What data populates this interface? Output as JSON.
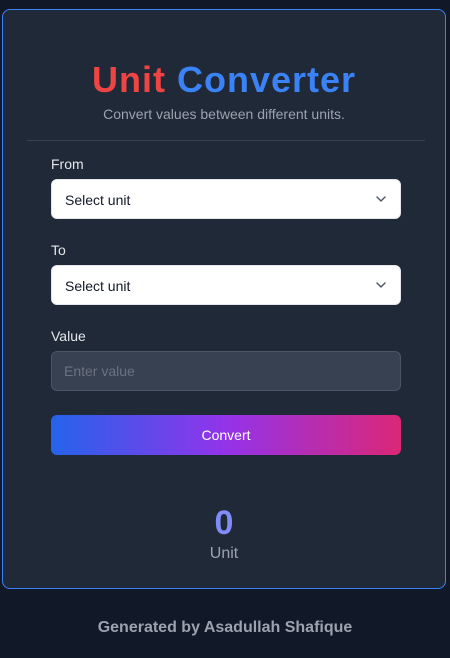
{
  "header": {
    "title_part1": "Unit",
    "title_part2": "Converter",
    "subtitle": "Convert values between different units."
  },
  "form": {
    "from_label": "From",
    "from_selected": "Select unit",
    "to_label": "To",
    "to_selected": "Select unit",
    "value_label": "Value",
    "value_placeholder": "Enter value",
    "value_current": "",
    "convert_label": "Convert"
  },
  "result": {
    "value": "0",
    "unit": "Unit"
  },
  "footer": {
    "text": "Generated by Asadullah Shafique"
  },
  "colors": {
    "title_part1": "#ef4444",
    "title_part2": "#3b82f6",
    "card_border": "#3b82f6",
    "result_value": "#818cf8",
    "button_gradient": [
      "#2563eb",
      "#9333ea",
      "#db2777"
    ]
  },
  "icons": {
    "select_chevron": "chevron-down-icon"
  }
}
